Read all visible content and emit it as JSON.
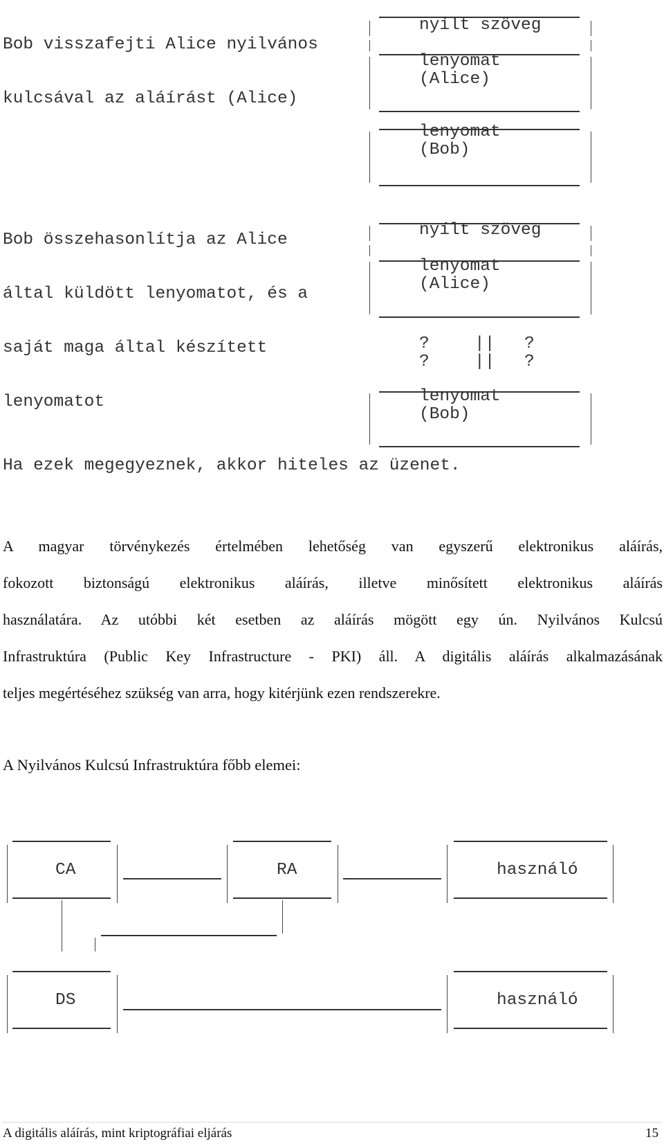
{
  "verification_diagram": {
    "step1_text_line1": "Bob visszafejti Alice nyilvános",
    "step1_text_line2": "kulcsával az aláírást (Alice)",
    "step2_text_line1": "Bob összehasonlítja az Alice",
    "step2_text_line2": "által küldött lenyomatot, és a",
    "step2_text_line3": "saját maga által készített",
    "step2_text_line4": "lenyomatot",
    "conclusion": "Ha ezek megegyeznek, akkor hiteles az üzenet.",
    "box1": {
      "plaintext": "nyílt szöveg",
      "digest_line1": "lenyomat",
      "digest_line2": "(Alice)"
    },
    "box_bob1": {
      "digest_line1": "lenyomat",
      "digest_line2": "(Bob)"
    },
    "box2": {
      "plaintext": "nyílt szöveg",
      "digest_line1": "lenyomat",
      "digest_line2": "(Alice)"
    },
    "compare_row1": [
      "?",
      "||",
      "?"
    ],
    "compare_row2": [
      "?",
      "||",
      "?"
    ],
    "box_bob2": {
      "digest_line1": "lenyomat",
      "digest_line2": "(Bob)"
    }
  },
  "paragraph": {
    "lines": [
      "A magyar törvénykezés értelmében lehetőség van egyszerű elektronikus aláírás,",
      "fokozott biztonságú elektronikus aláírás, illetve minősített elektronikus aláírás",
      "használatára. Az utóbbi két esetben az aláírás mögött egy ún. Nyilvános Kulcsú",
      "Infrastruktúra (Public Key Infrastructure - PKI) áll. A digitális aláírás alkalmazásának",
      "teljes megértéséhez szükség van arra, hogy kitérjünk ezen rendszerekre."
    ]
  },
  "pki_heading": "A Nyilvános Kulcsú Infrastruktúra főbb elemei:",
  "pki_diagram": {
    "ca": "CA",
    "ra": "RA",
    "user1": "használó",
    "ds": "DS",
    "user2": "használó"
  },
  "footer": {
    "title": "A digitális aláírás, mint kriptográfiai eljárás",
    "page_number": "15"
  }
}
